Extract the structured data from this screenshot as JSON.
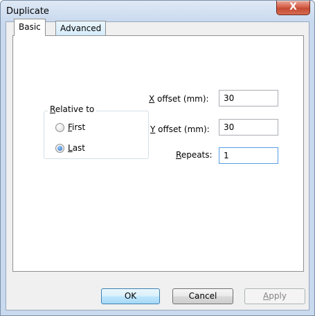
{
  "window": {
    "title": "Duplicate",
    "close_glyph": "X"
  },
  "tabs": [
    {
      "label": "Basic",
      "selected": true
    },
    {
      "label": "Advanced",
      "selected": false
    }
  ],
  "relative_group": {
    "label_access": "R",
    "label_rest": "elative to",
    "options": [
      {
        "access": "F",
        "rest": "irst",
        "checked": false
      },
      {
        "access": "L",
        "rest": "ast",
        "checked": true
      }
    ]
  },
  "fields": {
    "x_offset": {
      "access": "X",
      "rest": " offset (mm):",
      "value": "30"
    },
    "y_offset": {
      "access": "Y",
      "rest": " offset (mm):",
      "value": "30"
    },
    "repeats": {
      "access": "R",
      "rest": "epeats:",
      "value": "1"
    }
  },
  "buttons": {
    "ok": "OK",
    "cancel": "Cancel",
    "apply_access": "A",
    "apply_rest": "pply"
  },
  "colors": {
    "accent": "#3c7fb1",
    "close": "#c44a33"
  }
}
